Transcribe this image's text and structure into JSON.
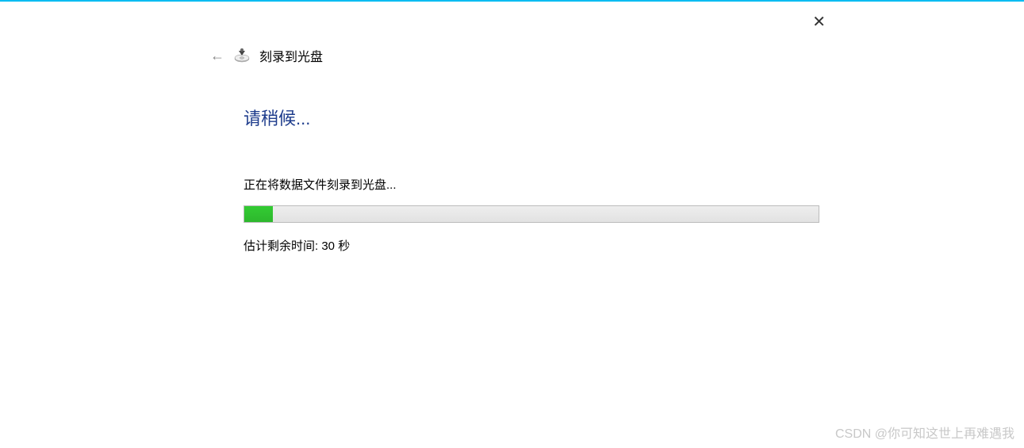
{
  "dialog": {
    "title": "刻录到光盘",
    "close_symbol": "✕"
  },
  "content": {
    "wait_heading": "请稍候...",
    "status_text": "正在将数据文件刻录到光盘...",
    "time_label": "估计剩余时间: 30 秒",
    "progress_percent": 5
  },
  "watermark": "CSDN @你可知这世上再难遇我"
}
